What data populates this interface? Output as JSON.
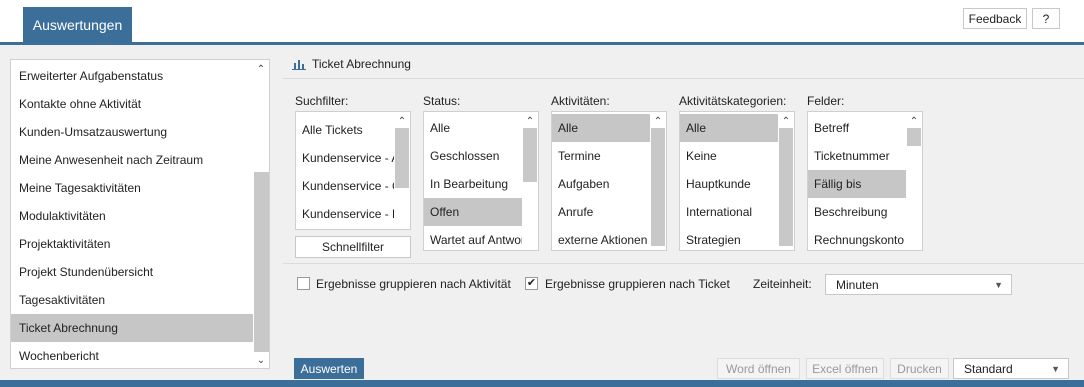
{
  "header": {
    "tab_label": "Auswertungen",
    "feedback_label": "Feedback",
    "help_label": "?"
  },
  "reports": {
    "items": [
      "Erweiterter Aufgabenstatus",
      "Kontakte ohne Aktivität",
      "Kunden-Umsatzauswertung",
      "Meine Anwesenheit nach Zeitraum",
      "Meine Tagesaktivitäten",
      "Modulaktivitäten",
      "Projektaktivitäten",
      "Projekt Stundenübersicht",
      "Tagesaktivitäten",
      "Ticket Abrechnung",
      "Wochenbericht"
    ],
    "selected": "Ticket Abrechnung"
  },
  "panel": {
    "title": "Ticket Abrechnung",
    "title_icon": "bar-chart-icon"
  },
  "filters": {
    "suchfilter": {
      "label": "Suchfilter:",
      "items": [
        "Alle Tickets",
        "Kundenservice - A",
        "Kundenservice - G",
        "Kundenservice - E"
      ],
      "button": "Schnellfilter"
    },
    "status": {
      "label": "Status:",
      "items": [
        "Alle",
        "Geschlossen",
        "In Bearbeitung",
        "Offen",
        "Wartet auf Antwort"
      ],
      "selected": [
        "Offen"
      ]
    },
    "aktivitaeten": {
      "label": "Aktivitäten:",
      "items": [
        "Alle",
        "Termine",
        "Aufgaben",
        "Anrufe",
        "externe Aktionen"
      ],
      "selected": [
        "Alle"
      ]
    },
    "kategorien": {
      "label": "Aktivitätskategorien:",
      "items": [
        "Alle",
        "Keine",
        "Hauptkunde",
        "International",
        "Strategien"
      ],
      "selected": [
        "Alle"
      ]
    },
    "felder": {
      "label": "Felder:",
      "items": [
        "Betreff",
        "Ticketnummer",
        "Fällig bis",
        "Beschreibung",
        "Rechnungskonto"
      ],
      "selected": [
        "Fällig bis"
      ]
    }
  },
  "options": {
    "group_activity_label": "Ergebnisse gruppieren nach Aktivität",
    "group_activity_checked": false,
    "group_ticket_label": "Ergebnisse gruppieren nach Ticket",
    "group_ticket_checked": true,
    "checkmark": "✔",
    "zeiteinheit_label": "Zeiteinheit:",
    "zeiteinheit_value": "Minuten"
  },
  "actions": {
    "auswerten": "Auswerten",
    "word": "Word öffnen",
    "excel": "Excel öffnen",
    "drucken": "Drucken",
    "template_value": "Standard"
  },
  "colors": {
    "accent": "#3c6e9a",
    "selection": "#c6c6c6"
  }
}
